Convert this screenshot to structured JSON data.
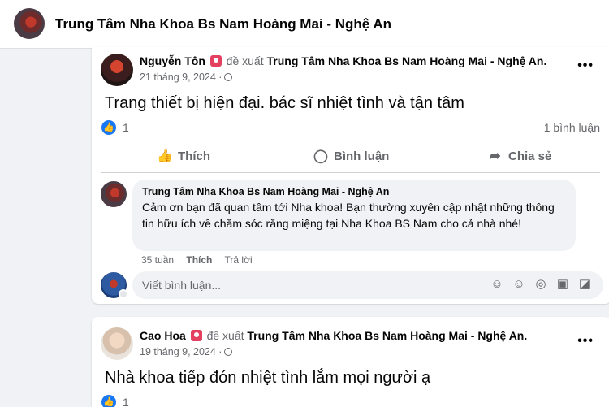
{
  "header": {
    "title": "Trung Tâm Nha Khoa Bs Nam Hoàng Mai - Nghệ An"
  },
  "posts": [
    {
      "author": "Nguyễn Tôn",
      "recommends": "đề xuất",
      "page": "Trung Tâm Nha Khoa Bs Nam Hoàng Mai - Nghệ An.",
      "date": "21 tháng 9, 2024 ·",
      "text": "Trang thiết bị hiện đại. bác sĩ nhiệt tình và tận tâm",
      "likes": "1",
      "comments": "1 bình luận",
      "actions": {
        "like": "Thích",
        "comment": "Bình luận",
        "share": "Chia sẻ"
      },
      "reply": {
        "author": "Trung Tâm Nha Khoa Bs Nam Hoàng Mai - Nghệ An",
        "text": "Cảm ơn bạn đã quan tâm tới Nha khoa! Bạn thường xuyên cập nhật những thông tin hữu ích về chăm sóc răng miệng tại Nha Khoa BS Nam cho cả nhà nhé!",
        "time": "35 tuần",
        "like": "Thích",
        "reply": "Trả lời"
      },
      "comment_placeholder": "Viết bình luận...",
      "more": "•••"
    },
    {
      "author": "Cao Hoa",
      "recommends": "đề xuất",
      "page": "Trung Tâm Nha Khoa Bs Nam Hoàng Mai - Nghệ An.",
      "date": "19 tháng 9, 2024 ·",
      "text": "Nhà khoa tiếp đón nhiệt tình lắm mọi người ạ",
      "likes": "1",
      "more": "•••"
    }
  ],
  "colors": {
    "accent": "#1877f2",
    "badge": "#e4405f",
    "muted": "#65676b",
    "background": "#f0f2f5"
  },
  "icons": [
    "page-avatar",
    "recommend-badge-icon",
    "globe-icon",
    "more-icon",
    "like-reaction-icon",
    "thumbs-up-icon",
    "comment-icon",
    "share-icon",
    "emoji-icon",
    "camera-icon",
    "gif-icon",
    "sticker-icon"
  ]
}
